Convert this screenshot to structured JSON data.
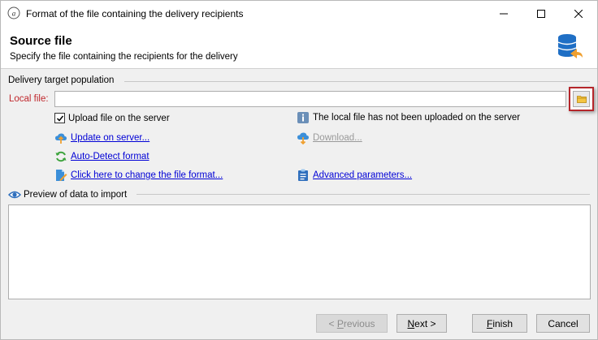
{
  "window": {
    "title": "Format of the file containing the delivery recipients"
  },
  "header": {
    "title": "Source file",
    "subtitle": "Specify the file containing the recipients for the delivery"
  },
  "target_group": {
    "label": "Delivery target population",
    "local_file_label": "Local file:",
    "local_file_value": "",
    "upload_checkbox": {
      "label": "Upload file on the server",
      "checked": true
    },
    "status_message": "The local file has not been uploaded on the server",
    "update_link": "Update on server...",
    "download_link": "Download...",
    "autodetect_link": "Auto-Detect format",
    "change_format_link": "Click here to change the file format...",
    "advanced_link": "Advanced parameters..."
  },
  "preview": {
    "label": "Preview of data to import"
  },
  "buttons": {
    "previous": {
      "mnemonic": "P",
      "rest": "revious",
      "prefix": "< "
    },
    "next": {
      "mnemonic": "N",
      "rest": "ext >"
    },
    "finish": {
      "mnemonic": "F",
      "rest": "inish"
    },
    "cancel": {
      "label": "Cancel"
    }
  },
  "colors": {
    "accent_red": "#c0282d",
    "link_blue": "#0000d6",
    "db_icon_blue": "#1f6fc5",
    "arrow_orange": "#f0a030"
  },
  "icons": {
    "app": "app-logo-icon",
    "header": "database-undo-icon",
    "browse": "folder-icon",
    "info": "info-icon",
    "upload": "cloud-upload-icon",
    "download": "cloud-download-icon",
    "autodetect": "refresh-icon",
    "format": "edit-document-icon",
    "advanced": "clipboard-list-icon",
    "preview": "eye-icon"
  }
}
